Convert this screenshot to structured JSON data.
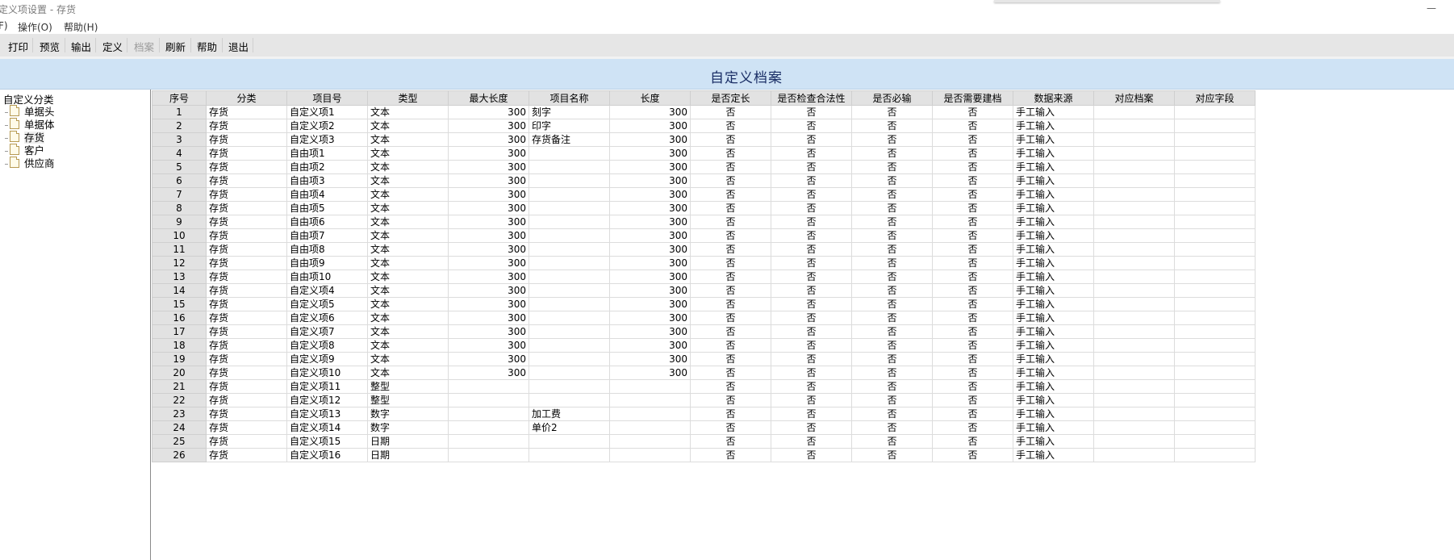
{
  "window": {
    "title": "定义项设置 - 存货"
  },
  "menu": [
    {
      "label": "F)"
    },
    {
      "label": "操作(O)"
    },
    {
      "label": "帮助(H)"
    }
  ],
  "toolbar": [
    {
      "label": "打印",
      "enabled": true
    },
    {
      "label": "预览",
      "enabled": true
    },
    {
      "label": "输出",
      "enabled": true
    },
    {
      "label": "定义",
      "enabled": true
    },
    {
      "label": "档案",
      "enabled": false
    },
    {
      "label": "刷新",
      "enabled": true
    },
    {
      "label": "帮助",
      "enabled": true
    },
    {
      "label": "退出",
      "enabled": true
    }
  ],
  "page_title": "自定义档案",
  "tree": {
    "root": "自定义分类",
    "items": [
      {
        "label": "单据头",
        "icon": "document-icon"
      },
      {
        "label": "单据体",
        "icon": "document-icon"
      },
      {
        "label": "存货",
        "icon": "document-icon",
        "selected": true
      },
      {
        "label": "客户",
        "icon": "document-icon"
      },
      {
        "label": "供应商",
        "icon": "document-icon"
      }
    ]
  },
  "grid": {
    "columns": [
      "序号",
      "分类",
      "项目号",
      "类型",
      "最大长度",
      "项目名称",
      "长度",
      "是否定长",
      "是否检查合法性",
      "是否必输",
      "是否需要建档",
      "数据来源",
      "对应档案",
      "对应字段"
    ],
    "rows": [
      [
        "1",
        "存货",
        "自定义项1",
        "文本",
        "300",
        "刻字",
        "300",
        "否",
        "否",
        "否",
        "否",
        "手工输入",
        "",
        ""
      ],
      [
        "2",
        "存货",
        "自定义项2",
        "文本",
        "300",
        "印字",
        "300",
        "否",
        "否",
        "否",
        "否",
        "手工输入",
        "",
        ""
      ],
      [
        "3",
        "存货",
        "自定义项3",
        "文本",
        "300",
        "存货备注",
        "300",
        "否",
        "否",
        "否",
        "否",
        "手工输入",
        "",
        ""
      ],
      [
        "4",
        "存货",
        "自由项1",
        "文本",
        "300",
        "",
        "300",
        "否",
        "否",
        "否",
        "否",
        "手工输入",
        "",
        ""
      ],
      [
        "5",
        "存货",
        "自由项2",
        "文本",
        "300",
        "",
        "300",
        "否",
        "否",
        "否",
        "否",
        "手工输入",
        "",
        ""
      ],
      [
        "6",
        "存货",
        "自由项3",
        "文本",
        "300",
        "",
        "300",
        "否",
        "否",
        "否",
        "否",
        "手工输入",
        "",
        ""
      ],
      [
        "7",
        "存货",
        "自由项4",
        "文本",
        "300",
        "",
        "300",
        "否",
        "否",
        "否",
        "否",
        "手工输入",
        "",
        ""
      ],
      [
        "8",
        "存货",
        "自由项5",
        "文本",
        "300",
        "",
        "300",
        "否",
        "否",
        "否",
        "否",
        "手工输入",
        "",
        ""
      ],
      [
        "9",
        "存货",
        "自由项6",
        "文本",
        "300",
        "",
        "300",
        "否",
        "否",
        "否",
        "否",
        "手工输入",
        "",
        ""
      ],
      [
        "10",
        "存货",
        "自由项7",
        "文本",
        "300",
        "",
        "300",
        "否",
        "否",
        "否",
        "否",
        "手工输入",
        "",
        ""
      ],
      [
        "11",
        "存货",
        "自由项8",
        "文本",
        "300",
        "",
        "300",
        "否",
        "否",
        "否",
        "否",
        "手工输入",
        "",
        ""
      ],
      [
        "12",
        "存货",
        "自由项9",
        "文本",
        "300",
        "",
        "300",
        "否",
        "否",
        "否",
        "否",
        "手工输入",
        "",
        ""
      ],
      [
        "13",
        "存货",
        "自由项10",
        "文本",
        "300",
        "",
        "300",
        "否",
        "否",
        "否",
        "否",
        "手工输入",
        "",
        ""
      ],
      [
        "14",
        "存货",
        "自定义项4",
        "文本",
        "300",
        "",
        "300",
        "否",
        "否",
        "否",
        "否",
        "手工输入",
        "",
        ""
      ],
      [
        "15",
        "存货",
        "自定义项5",
        "文本",
        "300",
        "",
        "300",
        "否",
        "否",
        "否",
        "否",
        "手工输入",
        "",
        ""
      ],
      [
        "16",
        "存货",
        "自定义项6",
        "文本",
        "300",
        "",
        "300",
        "否",
        "否",
        "否",
        "否",
        "手工输入",
        "",
        ""
      ],
      [
        "17",
        "存货",
        "自定义项7",
        "文本",
        "300",
        "",
        "300",
        "否",
        "否",
        "否",
        "否",
        "手工输入",
        "",
        ""
      ],
      [
        "18",
        "存货",
        "自定义项8",
        "文本",
        "300",
        "",
        "300",
        "否",
        "否",
        "否",
        "否",
        "手工输入",
        "",
        ""
      ],
      [
        "19",
        "存货",
        "自定义项9",
        "文本",
        "300",
        "",
        "300",
        "否",
        "否",
        "否",
        "否",
        "手工输入",
        "",
        ""
      ],
      [
        "20",
        "存货",
        "自定义项10",
        "文本",
        "300",
        "",
        "300",
        "否",
        "否",
        "否",
        "否",
        "手工输入",
        "",
        ""
      ],
      [
        "21",
        "存货",
        "自定义项11",
        "整型",
        "",
        "",
        "",
        "否",
        "否",
        "否",
        "否",
        "手工输入",
        "",
        ""
      ],
      [
        "22",
        "存货",
        "自定义项12",
        "整型",
        "",
        "",
        "",
        "否",
        "否",
        "否",
        "否",
        "手工输入",
        "",
        ""
      ],
      [
        "23",
        "存货",
        "自定义项13",
        "数字",
        "",
        "加工费",
        "",
        "否",
        "否",
        "否",
        "否",
        "手工输入",
        "",
        ""
      ],
      [
        "24",
        "存货",
        "自定义项14",
        "数字",
        "",
        "单价2",
        "",
        "否",
        "否",
        "否",
        "否",
        "手工输入",
        "",
        ""
      ],
      [
        "25",
        "存货",
        "自定义项15",
        "日期",
        "",
        "",
        "",
        "否",
        "否",
        "否",
        "否",
        "手工输入",
        "",
        ""
      ],
      [
        "26",
        "存货",
        "自定义项16",
        "日期",
        "",
        "",
        "",
        "否",
        "否",
        "否",
        "否",
        "手工输入",
        "",
        ""
      ]
    ]
  }
}
